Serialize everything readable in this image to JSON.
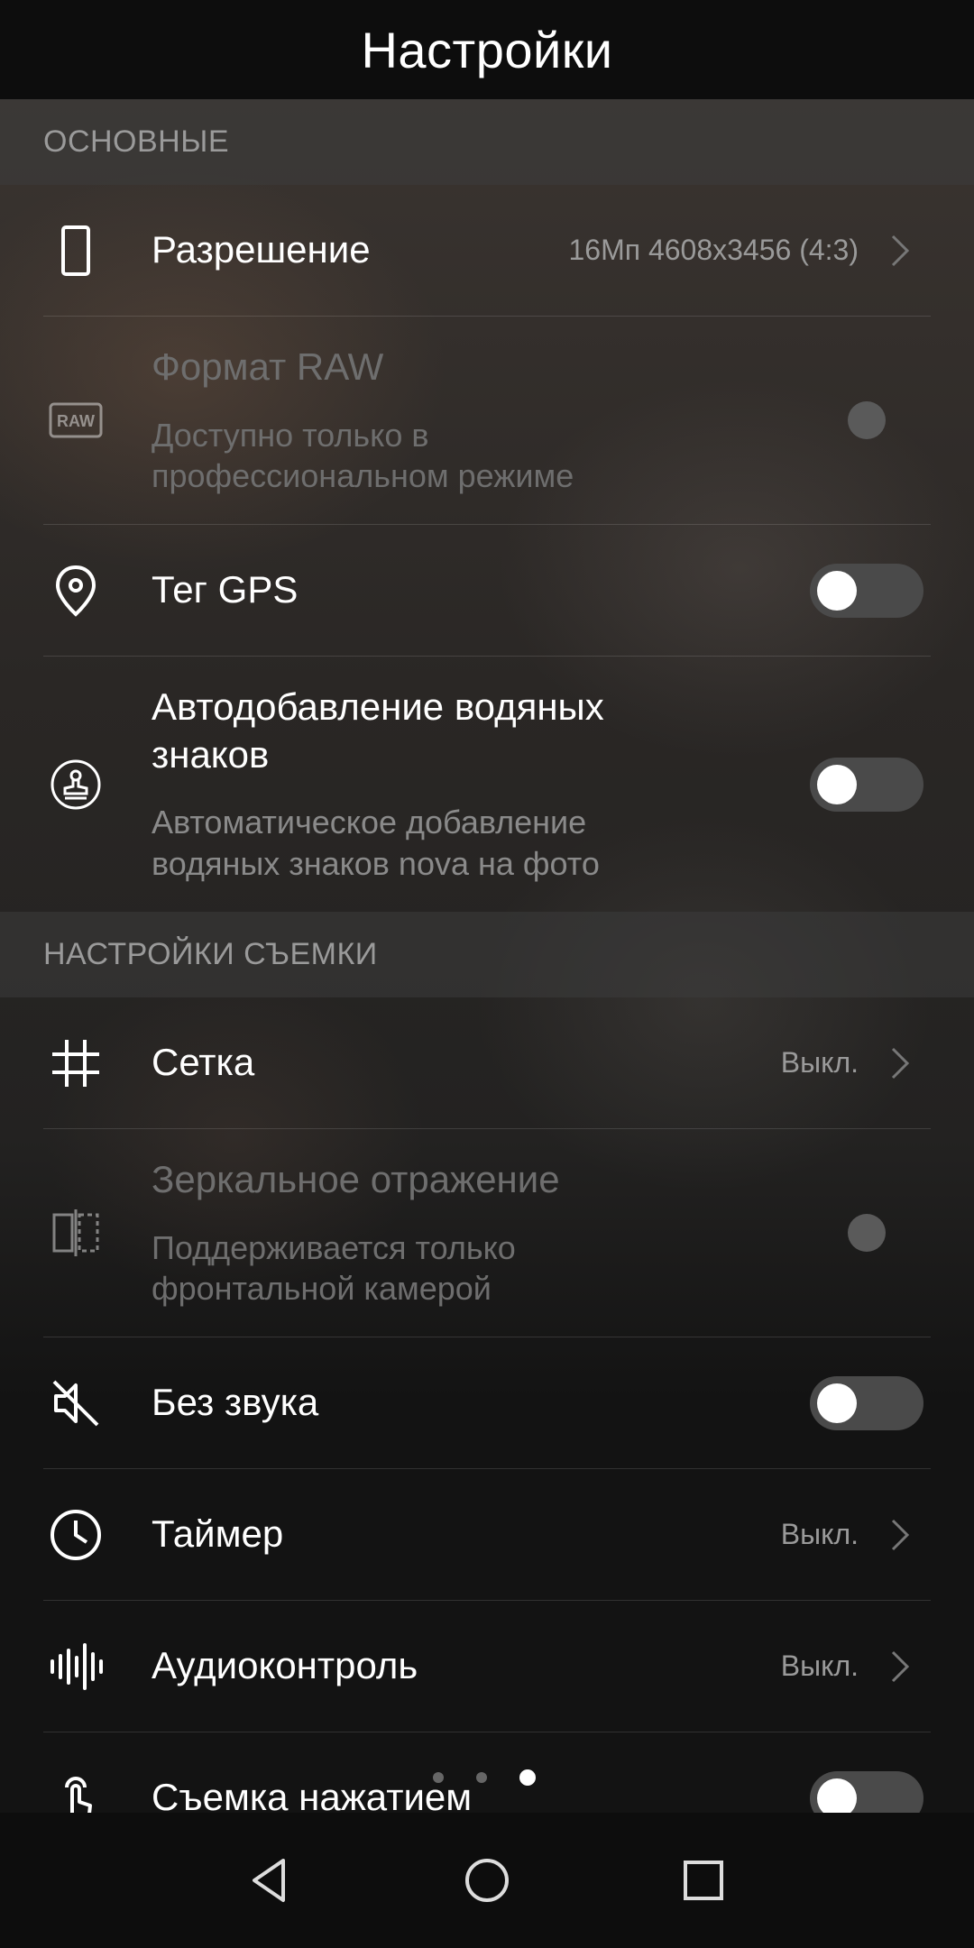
{
  "header": {
    "title": "Настройки"
  },
  "sections": {
    "basic": "ОСНОВНЫЕ",
    "shooting": "НАСТРОЙКИ СЪЕМКИ"
  },
  "items": {
    "resolution": {
      "label": "Разрешение",
      "value": "16Мп 4608x3456 (4:3)",
      "icon": "phone-icon"
    },
    "raw": {
      "label": "Формат RAW",
      "sub": "Доступно только в профессиональном режиме",
      "icon": "raw-icon",
      "enabled": false
    },
    "gps": {
      "label": "Тег GPS",
      "icon": "location-pin-icon",
      "on": false
    },
    "watermark": {
      "label": "Автодобавление водяных знаков",
      "sub": "Автоматическое добавление водяных знаков nova на фото",
      "icon": "stamp-icon",
      "on": false
    },
    "grid": {
      "label": "Сетка",
      "value": "Выкл.",
      "icon": "grid-icon"
    },
    "mirror": {
      "label": "Зеркальное отражение",
      "sub": "Поддерживается только фронтальной камерой",
      "icon": "mirror-icon",
      "enabled": false
    },
    "mute": {
      "label": "Без звука",
      "icon": "mute-icon",
      "on": false
    },
    "timer": {
      "label": "Таймер",
      "value": "Выкл.",
      "icon": "clock-icon"
    },
    "audio": {
      "label": "Аудиоконтроль",
      "value": "Выкл.",
      "icon": "sound-wave-icon"
    },
    "touch": {
      "label": "Съемка нажатием",
      "icon": "touch-icon",
      "on": false
    }
  },
  "pager": {
    "count": 3,
    "active_index": 2
  },
  "navbar": [
    "back-icon",
    "home-icon",
    "recents-icon"
  ],
  "colors": {
    "background": "#131313",
    "toggle_off": "#4a4a4a",
    "secondary_text": "#8a8a8a"
  }
}
